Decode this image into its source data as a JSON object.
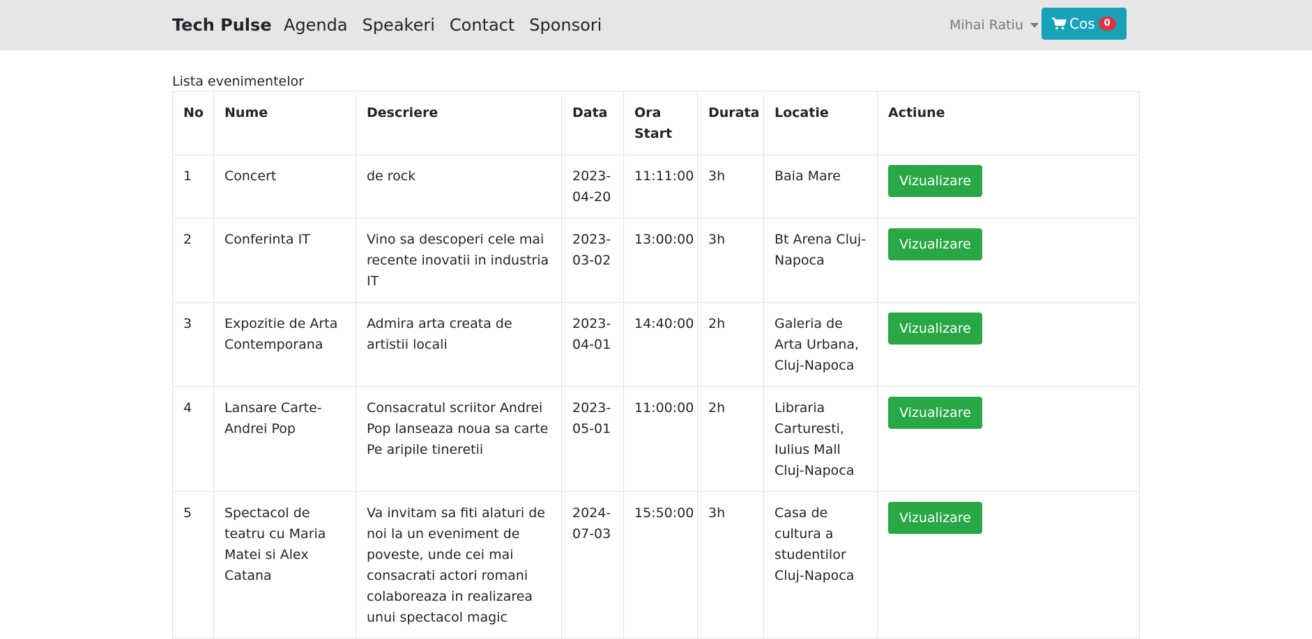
{
  "navbar": {
    "brand": "Tech Pulse",
    "links": [
      "Agenda",
      "Speakeri",
      "Contact",
      "Sponsori"
    ],
    "user": "Mihai Ratiu",
    "cart_label": "Cos",
    "cart_count": "0"
  },
  "caption": "Lista evenimentelor",
  "table": {
    "headers": [
      "No",
      "Nume",
      "Descriere",
      "Data",
      "Ora Start",
      "Durata",
      "Locatie",
      "Actiune"
    ],
    "action_label": "Vizualizare",
    "rows": [
      {
        "no": "1",
        "nume": "Concert",
        "descriere": "de rock",
        "data": "2023-04-20",
        "ora": "11:11:00",
        "durata": "3h",
        "locatie": "Baia Mare"
      },
      {
        "no": "2",
        "nume": "Conferinta IT",
        "descriere": "Vino sa descoperi cele mai recente inovatii in industria IT",
        "data": "2023-03-02",
        "ora": "13:00:00",
        "durata": "3h",
        "locatie": "Bt Arena Cluj-Napoca"
      },
      {
        "no": "3",
        "nume": "Expozitie de Arta Contemporana",
        "descriere": "Admira arta creata de artistii locali",
        "data": "2023-04-01",
        "ora": "14:40:00",
        "durata": "2h",
        "locatie": "Galeria de Arta Urbana, Cluj-Napoca"
      },
      {
        "no": "4",
        "nume": "Lansare Carte-Andrei Pop",
        "descriere": "Consacratul scriitor Andrei Pop lanseaza noua sa carte Pe aripile tineretii",
        "data": "2023-05-01",
        "ora": "11:00:00",
        "durata": "2h",
        "locatie": "Libraria Carturesti, Iulius Mall Cluj-Napoca"
      },
      {
        "no": "5",
        "nume": "Spectacol de teatru cu Maria Matei si Alex Catana",
        "descriere": "Va invitam sa fiti alaturi de noi la un eveniment de poveste, unde cei mai consacrati actori romani colaboreaza in realizarea unui spectacol magic",
        "data": "2024-07-03",
        "ora": "15:50:00",
        "durata": "3h",
        "locatie": "Casa de cultura a studentilor Cluj-Napoca"
      }
    ]
  },
  "icons": {
    "cart": "shopping-cart-icon",
    "user_caret": "caret-down-icon"
  },
  "colors": {
    "navbar_bg": "#e6e6e6",
    "cart_button": "#17a2b8",
    "badge": "#dc3545",
    "view_button": "#28a745"
  }
}
